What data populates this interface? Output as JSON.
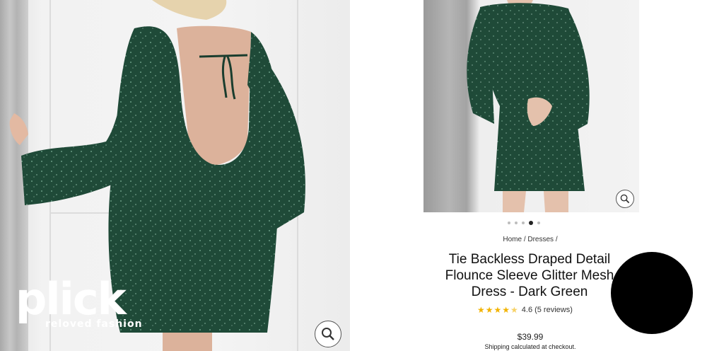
{
  "logo": {
    "word": "plick",
    "tagline": "reloved fashion"
  },
  "product": {
    "breadcrumb": "Home / Dresses /",
    "title_lines": [
      "Tie Backless Draped Detail",
      "Flounce Sleeve Glitter Mesh",
      "Dress - Dark Green"
    ],
    "rating_value": "4.6",
    "reviews": "(5 reviews)",
    "stars": 4.6,
    "price": "$39.99",
    "shipping": "Shipping calculated at checkout."
  },
  "carousel": {
    "count": 5,
    "active_index": 3
  },
  "icons": {
    "zoom": "magnifier-icon",
    "star": "star-icon"
  },
  "colors": {
    "dress": "#1f4a38",
    "star": "#f2b300"
  }
}
